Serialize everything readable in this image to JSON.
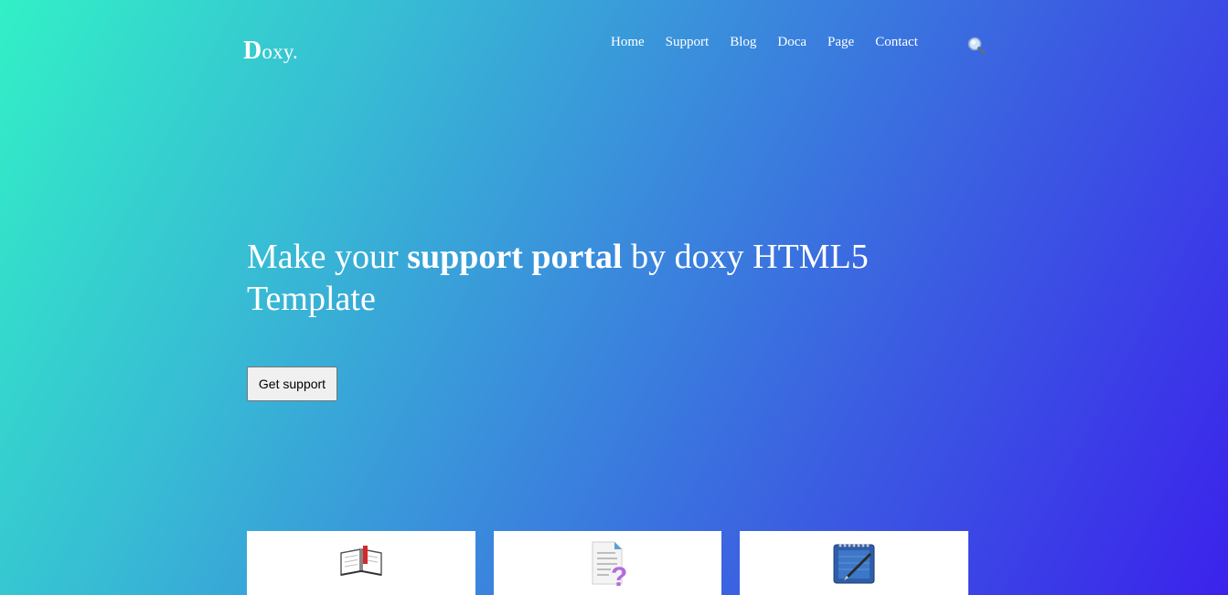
{
  "brand": {
    "initial": "D",
    "rest": "oxy."
  },
  "nav": {
    "items": [
      {
        "label": "Home"
      },
      {
        "label": "Support"
      },
      {
        "label": "Blog"
      },
      {
        "label": "Doca"
      },
      {
        "label": "Page"
      },
      {
        "label": "Contact"
      }
    ],
    "search_icon": "magnifier-icon"
  },
  "hero": {
    "headline_part1": "Make your ",
    "headline_strong": "support portal",
    "headline_part2": " by doxy HTML5 Template",
    "cta_label": "Get support"
  },
  "cards": [
    {
      "icon": "open-book-icon"
    },
    {
      "icon": "help-document-icon"
    },
    {
      "icon": "notepad-pen-icon"
    }
  ],
  "colors": {
    "gradient_start": "#32f0c6",
    "gradient_end": "#3b22ec",
    "text": "#ffffff",
    "card_bg": "#ffffff"
  }
}
